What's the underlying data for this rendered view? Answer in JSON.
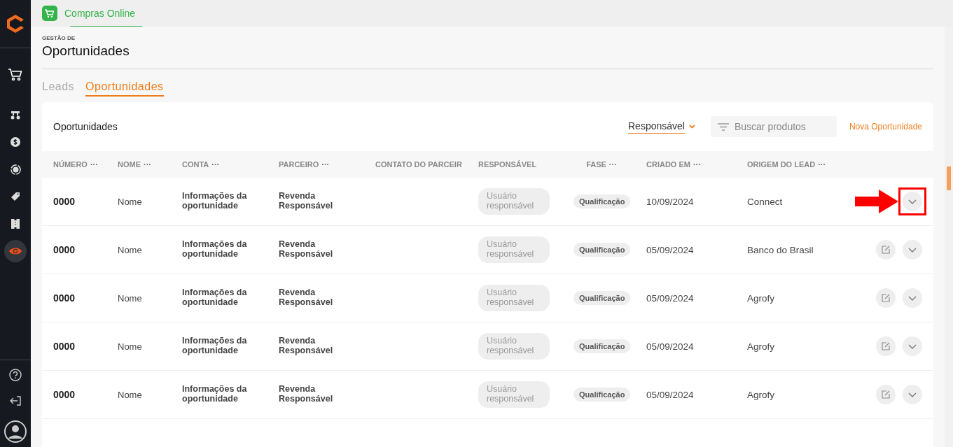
{
  "top_tab": {
    "label": "Compras Online",
    "selected": true
  },
  "sidebar": {
    "items": [
      {
        "selected": false
      },
      {
        "selected": false
      },
      {
        "selected": false
      },
      {
        "selected": false
      },
      {
        "selected": false
      },
      {
        "selected": false
      },
      {
        "selected": true
      }
    ]
  },
  "header": {
    "overline": "GESTÃO DE",
    "title": "Oportunidades"
  },
  "tabs": [
    {
      "label": "Leads",
      "selected": false
    },
    {
      "label": "Oportunidades",
      "selected": true
    }
  ],
  "card": {
    "title": "Oportunidades",
    "filter": "Responsável",
    "search": {
      "placeholder": "Buscar produtos"
    },
    "new_button": "Nova Oportunidade"
  },
  "table": {
    "columns": [
      {
        "label": "NÚMERO",
        "menu": "···"
      },
      {
        "label": "NOME",
        "menu": "···"
      },
      {
        "label": "CONTA",
        "menu": "···"
      },
      {
        "label": "PARCEIRO",
        "menu": "···"
      },
      {
        "label": "CONTATO DO PARCEIR"
      },
      {
        "label": "RESPONSÁVEL"
      },
      {
        "label": "FASE",
        "menu": "···"
      },
      {
        "label": "CRIADO EM",
        "menu": "···"
      },
      {
        "label": "ORIGEM DO LEAD",
        "menu": "···"
      }
    ],
    "rows": [
      {
        "numero": "0000",
        "nome": "Nome",
        "conta": "Informações da oportunidade",
        "parceiro": "Revenda Responsável",
        "responsavel": "Usuário responsável",
        "fase": "Qualificação",
        "criado": "10/09/2024",
        "origem": "Connect",
        "highlighted": true
      },
      {
        "numero": "0000",
        "nome": "Nome",
        "conta": "Informações da oportunidade",
        "parceiro": "Revenda Responsável",
        "responsavel": "Usuário responsável",
        "fase": "Qualificação",
        "criado": "05/09/2024",
        "origem": "Banco do Brasil",
        "highlighted": false
      },
      {
        "numero": "0000",
        "nome": "Nome",
        "conta": "Informações da oportunidade",
        "parceiro": "Revenda Responsável",
        "responsavel": "Usuário responsável",
        "fase": "Qualificação",
        "criado": "05/09/2024",
        "origem": "Agrofy",
        "highlighted": false
      },
      {
        "numero": "0000",
        "nome": "Nome",
        "conta": "Informações da oportunidade",
        "parceiro": "Revenda Responsável",
        "responsavel": "Usuário responsável",
        "fase": "Qualificação",
        "criado": "05/09/2024",
        "origem": "Agrofy",
        "highlighted": false
      },
      {
        "numero": "0000",
        "nome": "Nome",
        "conta": "Informações da oportunidade",
        "parceiro": "Revenda Responsável",
        "responsavel": "Usuário responsável",
        "fase": "Qualificação",
        "criado": "05/09/2024",
        "origem": "Agrofy",
        "highlighted": false
      }
    ]
  }
}
